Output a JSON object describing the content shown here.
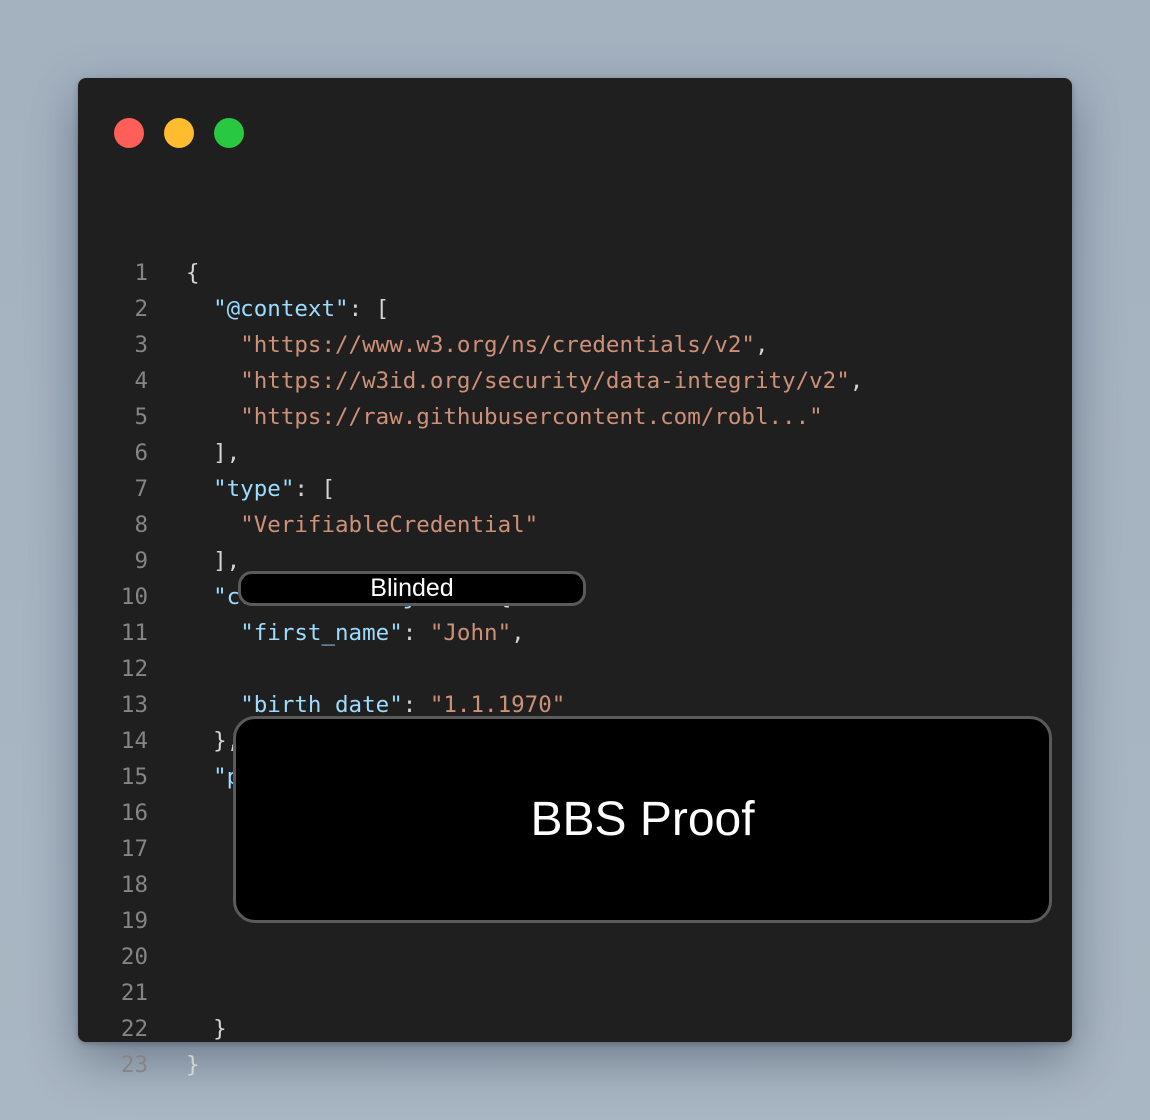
{
  "window": {
    "traffic_lights": [
      {
        "name": "close-dot",
        "color": "#ff5f57"
      },
      {
        "name": "minimize-dot",
        "color": "#febc2e"
      },
      {
        "name": "zoom-dot",
        "color": "#28c840"
      }
    ]
  },
  "code": {
    "line_numbers": [
      "1",
      "2",
      "3",
      "4",
      "5",
      "6",
      "7",
      "8",
      "9",
      "10",
      "11",
      "12",
      "13",
      "14",
      "15",
      "16",
      "17",
      "18",
      "19",
      "20",
      "21",
      "22",
      "23"
    ],
    "lines": [
      [
        {
          "t": "{",
          "c": "p"
        }
      ],
      [
        {
          "t": "  ",
          "c": "p"
        },
        {
          "t": "\"@context\"",
          "c": "k"
        },
        {
          "t": ": [",
          "c": "p"
        }
      ],
      [
        {
          "t": "    ",
          "c": "p"
        },
        {
          "t": "\"https://www.w3.org/ns/credentials/v2\"",
          "c": "s"
        },
        {
          "t": ",",
          "c": "p"
        }
      ],
      [
        {
          "t": "    ",
          "c": "p"
        },
        {
          "t": "\"https://w3id.org/security/data-integrity/v2\"",
          "c": "s"
        },
        {
          "t": ",",
          "c": "p"
        }
      ],
      [
        {
          "t": "    ",
          "c": "p"
        },
        {
          "t": "\"https://raw.githubusercontent.com/robl...\"",
          "c": "s"
        }
      ],
      [
        {
          "t": "  ],",
          "c": "p"
        }
      ],
      [
        {
          "t": "  ",
          "c": "p"
        },
        {
          "t": "\"type\"",
          "c": "k"
        },
        {
          "t": ": [",
          "c": "p"
        }
      ],
      [
        {
          "t": "    ",
          "c": "p"
        },
        {
          "t": "\"VerifiableCredential\"",
          "c": "s"
        }
      ],
      [
        {
          "t": "  ],",
          "c": "p"
        }
      ],
      [
        {
          "t": "  ",
          "c": "p"
        },
        {
          "t": "\"credentialSubject\"",
          "c": "k"
        },
        {
          "t": ": {",
          "c": "p"
        }
      ],
      [
        {
          "t": "    ",
          "c": "p"
        },
        {
          "t": "\"first_name\"",
          "c": "k"
        },
        {
          "t": ": ",
          "c": "p"
        },
        {
          "t": "\"John\"",
          "c": "s"
        },
        {
          "t": ",",
          "c": "p"
        }
      ],
      [],
      [
        {
          "t": "    ",
          "c": "p"
        },
        {
          "t": "\"birth_date\"",
          "c": "k"
        },
        {
          "t": ": ",
          "c": "p"
        },
        {
          "t": "\"1.1.1970\"",
          "c": "s"
        }
      ],
      [
        {
          "t": "  },",
          "c": "p"
        }
      ],
      [
        {
          "t": "  ",
          "c": "p"
        },
        {
          "t": "\"proof\"",
          "c": "k"
        },
        {
          "t": ": {",
          "c": "p"
        }
      ],
      [],
      [],
      [],
      [],
      [],
      [],
      [
        {
          "t": "  }",
          "c": "p"
        }
      ],
      [
        {
          "t": "}",
          "c": "p"
        }
      ]
    ]
  },
  "overlays": {
    "blinded_label": "Blinded",
    "bbs_label": "BBS Proof"
  }
}
